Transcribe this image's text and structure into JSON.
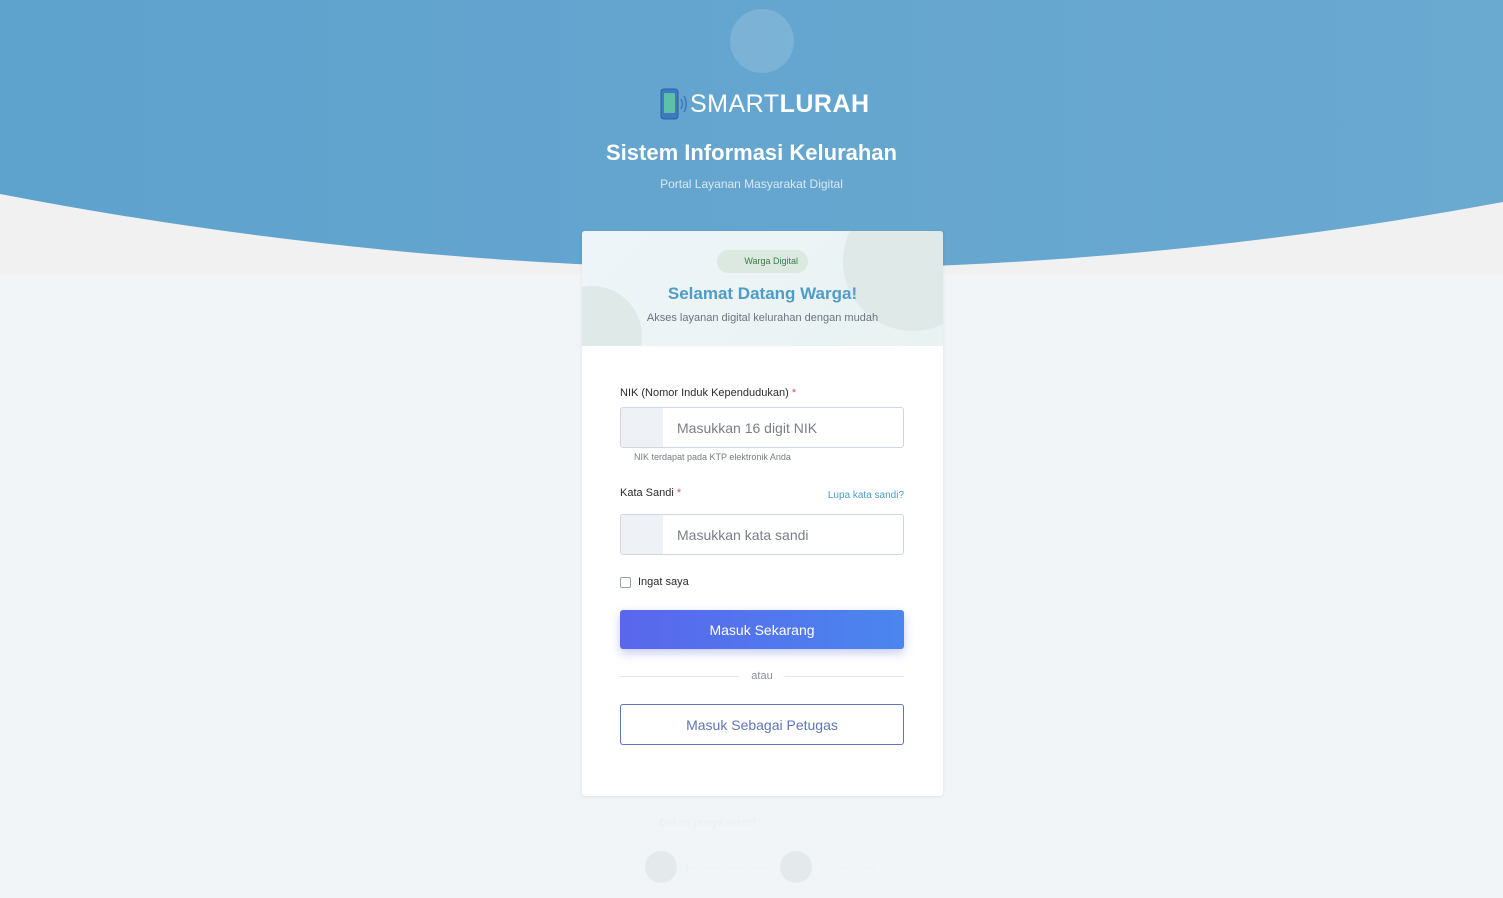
{
  "brand": {
    "logo_thin": "SMART",
    "logo_bold": "LURAH",
    "title": "Sistem Informasi Kelurahan",
    "subtitle": "Portal Layanan Masyarakat Digital"
  },
  "card": {
    "badge": "Warga Digital",
    "title": "Selamat Datang Warga!",
    "subtitle": "Akses layanan digital kelurahan dengan mudah"
  },
  "form": {
    "nik_label": "NIK (Nomor Induk Kependudukan)",
    "nik_placeholder": "Masukkan 16 digit NIK",
    "nik_value": "",
    "nik_help": "NIK terdapat pada KTP elektronik Anda",
    "password_label": "Kata Sandi",
    "password_placeholder": "Masukkan kata sandi",
    "password_value": "",
    "forgot_link": "Lupa kata sandi?",
    "required_mark": "*",
    "remember_label": "Ingat saya",
    "remember_checked": false,
    "submit_label": "Masuk Sekarang",
    "divider_label": "atau",
    "officer_label": "Masuk Sebagai Petugas"
  },
  "footer": {
    "register_prompt": "Belum punya akun?",
    "register_link": "Daftar Sekarang",
    "items": [
      {
        "label": "Layanan Terpercaya",
        "icon": "shield-icon"
      },
      {
        "label": "Proses Cepat",
        "icon": "bolt-icon"
      }
    ]
  },
  "colors": {
    "hero_blue": "#5fa3cf",
    "accent_text": "#4f9cc6",
    "primary_button_start": "#5a66ec",
    "primary_button_end": "#4b86ef",
    "secondary_button": "#5e76b8",
    "badge_text": "#3e7a45",
    "required": "#e05252"
  }
}
